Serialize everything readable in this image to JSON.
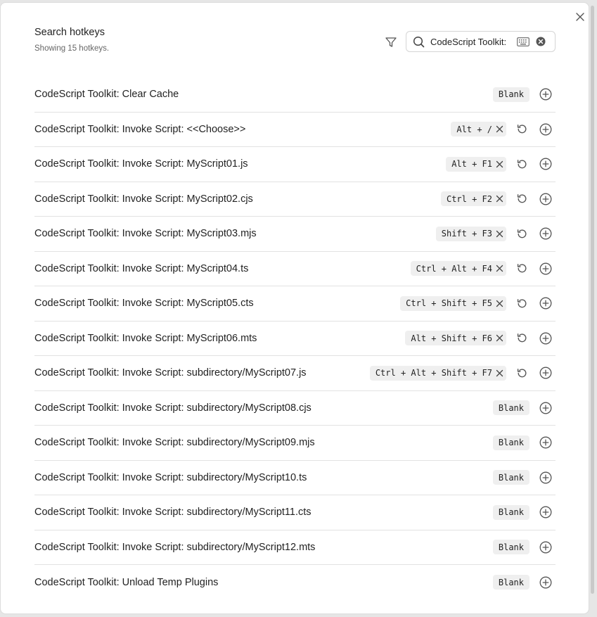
{
  "header": {
    "title": "Search hotkeys",
    "subtitle": "Showing 15 hotkeys."
  },
  "search": {
    "value": "CodeScript Toolkit:",
    "placeholder": ""
  },
  "icons": {
    "close": "close-icon",
    "filter": "filter-icon",
    "search": "search-icon",
    "keyboard": "keyboard-icon",
    "clear": "clear-circle-icon",
    "reset": "reset-icon",
    "add": "plus-circle-icon",
    "remove": "x-icon"
  },
  "rows": [
    {
      "label": "CodeScript Toolkit: Clear Cache",
      "hotkey": "Blank",
      "assigned": false
    },
    {
      "label": "CodeScript Toolkit: Invoke Script: <<Choose>>",
      "hotkey": "Alt + /",
      "assigned": true
    },
    {
      "label": "CodeScript Toolkit: Invoke Script: MyScript01.js",
      "hotkey": "Alt + F1",
      "assigned": true
    },
    {
      "label": "CodeScript Toolkit: Invoke Script: MyScript02.cjs",
      "hotkey": "Ctrl + F2",
      "assigned": true
    },
    {
      "label": "CodeScript Toolkit: Invoke Script: MyScript03.mjs",
      "hotkey": "Shift + F3",
      "assigned": true
    },
    {
      "label": "CodeScript Toolkit: Invoke Script: MyScript04.ts",
      "hotkey": "Ctrl + Alt + F4",
      "assigned": true
    },
    {
      "label": "CodeScript Toolkit: Invoke Script: MyScript05.cts",
      "hotkey": "Ctrl + Shift + F5",
      "assigned": true
    },
    {
      "label": "CodeScript Toolkit: Invoke Script: MyScript06.mts",
      "hotkey": "Alt + Shift + F6",
      "assigned": true
    },
    {
      "label": "CodeScript Toolkit: Invoke Script: subdirectory/MyScript07.js",
      "hotkey": "Ctrl + Alt + Shift + F7",
      "assigned": true
    },
    {
      "label": "CodeScript Toolkit: Invoke Script: subdirectory/MyScript08.cjs",
      "hotkey": "Blank",
      "assigned": false
    },
    {
      "label": "CodeScript Toolkit: Invoke Script: subdirectory/MyScript09.mjs",
      "hotkey": "Blank",
      "assigned": false
    },
    {
      "label": "CodeScript Toolkit: Invoke Script: subdirectory/MyScript10.ts",
      "hotkey": "Blank",
      "assigned": false
    },
    {
      "label": "CodeScript Toolkit: Invoke Script: subdirectory/MyScript11.cts",
      "hotkey": "Blank",
      "assigned": false
    },
    {
      "label": "CodeScript Toolkit: Invoke Script: subdirectory/MyScript12.mts",
      "hotkey": "Blank",
      "assigned": false
    },
    {
      "label": "CodeScript Toolkit: Unload Temp Plugins",
      "hotkey": "Blank",
      "assigned": false
    }
  ]
}
